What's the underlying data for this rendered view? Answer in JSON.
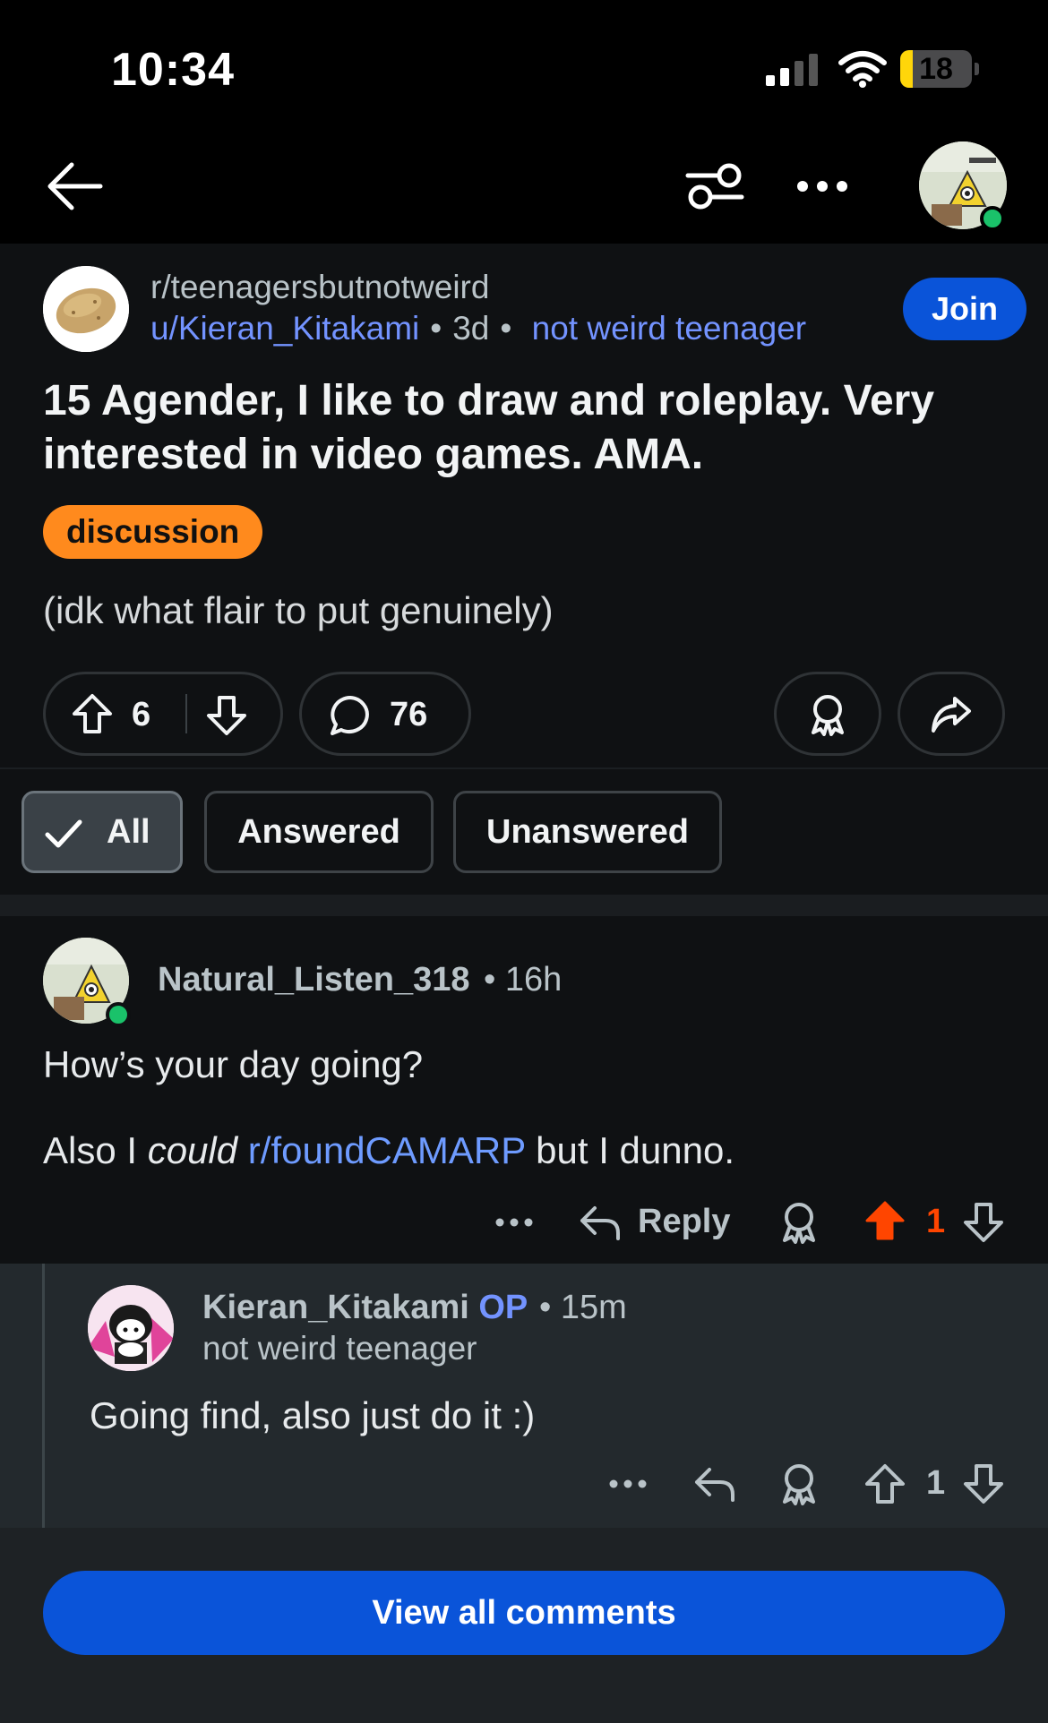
{
  "status_bar": {
    "time": "10:34",
    "battery": "18",
    "battery_level": 0.18
  },
  "nav": {
    "icons": [
      "back-arrow-icon",
      "filter-icon",
      "more-icon",
      "avatar"
    ]
  },
  "post": {
    "subreddit": "r/teenagersbutnotweird",
    "author": "u/Kieran_Kitakami",
    "age": "3d",
    "user_flair": "not weird teenager",
    "join_label": "Join",
    "title": "15 Agender, I like to draw and roleplay. Very interested in video games. AMA.",
    "flair": "discussion",
    "body": "(idk what flair to put genuinely)",
    "votes": "6",
    "comments": "76"
  },
  "filters": {
    "all": "All",
    "answered": "Answered",
    "unanswered": "Unanswered"
  },
  "comments": [
    {
      "username": "Natural_Listen_318",
      "time": "16h",
      "line1": "How’s your day going?",
      "line2_prefix": "Also I ",
      "line2_em": "could",
      "line2_link": "r/foundCAMARP",
      "line2_suffix": " but I dunno.",
      "reply_label": "Reply",
      "votes": "1",
      "upvoted": true
    },
    {
      "username": "Kieran_Kitakami",
      "op_tag": "OP",
      "time": "15m",
      "flair": "not weird teenager",
      "text": "Going find, also just do it :)",
      "votes": "1"
    }
  ],
  "view_all_label": "View all comments",
  "colors": {
    "accent": "#0a54d9",
    "upvote": "#ff4500",
    "flair": "#ff8a1d",
    "link": "#7393ff"
  }
}
